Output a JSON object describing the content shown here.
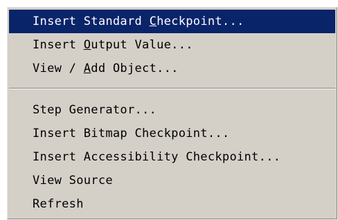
{
  "menu": {
    "items": [
      {
        "pre": "Insert Standard ",
        "mnemonic": "C",
        "post": "heckpoint...",
        "selected": true
      },
      {
        "pre": "Insert ",
        "mnemonic": "O",
        "post": "utput Value...",
        "selected": false
      },
      {
        "pre": "View / ",
        "mnemonic": "A",
        "post": "dd Object...",
        "selected": false
      },
      {
        "pre": "Step Generator...",
        "mnemonic": "",
        "post": "",
        "selected": false
      },
      {
        "pre": "Insert Bitmap Checkpoint...",
        "mnemonic": "",
        "post": "",
        "selected": false
      },
      {
        "pre": "Insert Accessibility Checkpoint...",
        "mnemonic": "",
        "post": "",
        "selected": false
      },
      {
        "pre": "View Source",
        "mnemonic": "",
        "post": "",
        "selected": false
      },
      {
        "pre": "Refresh",
        "mnemonic": "",
        "post": "",
        "selected": false
      }
    ]
  },
  "colors": {
    "menu_background": "#d4d0c8",
    "highlight": "#0a246a",
    "highlight_text": "#ffffff",
    "text": "#000000"
  }
}
